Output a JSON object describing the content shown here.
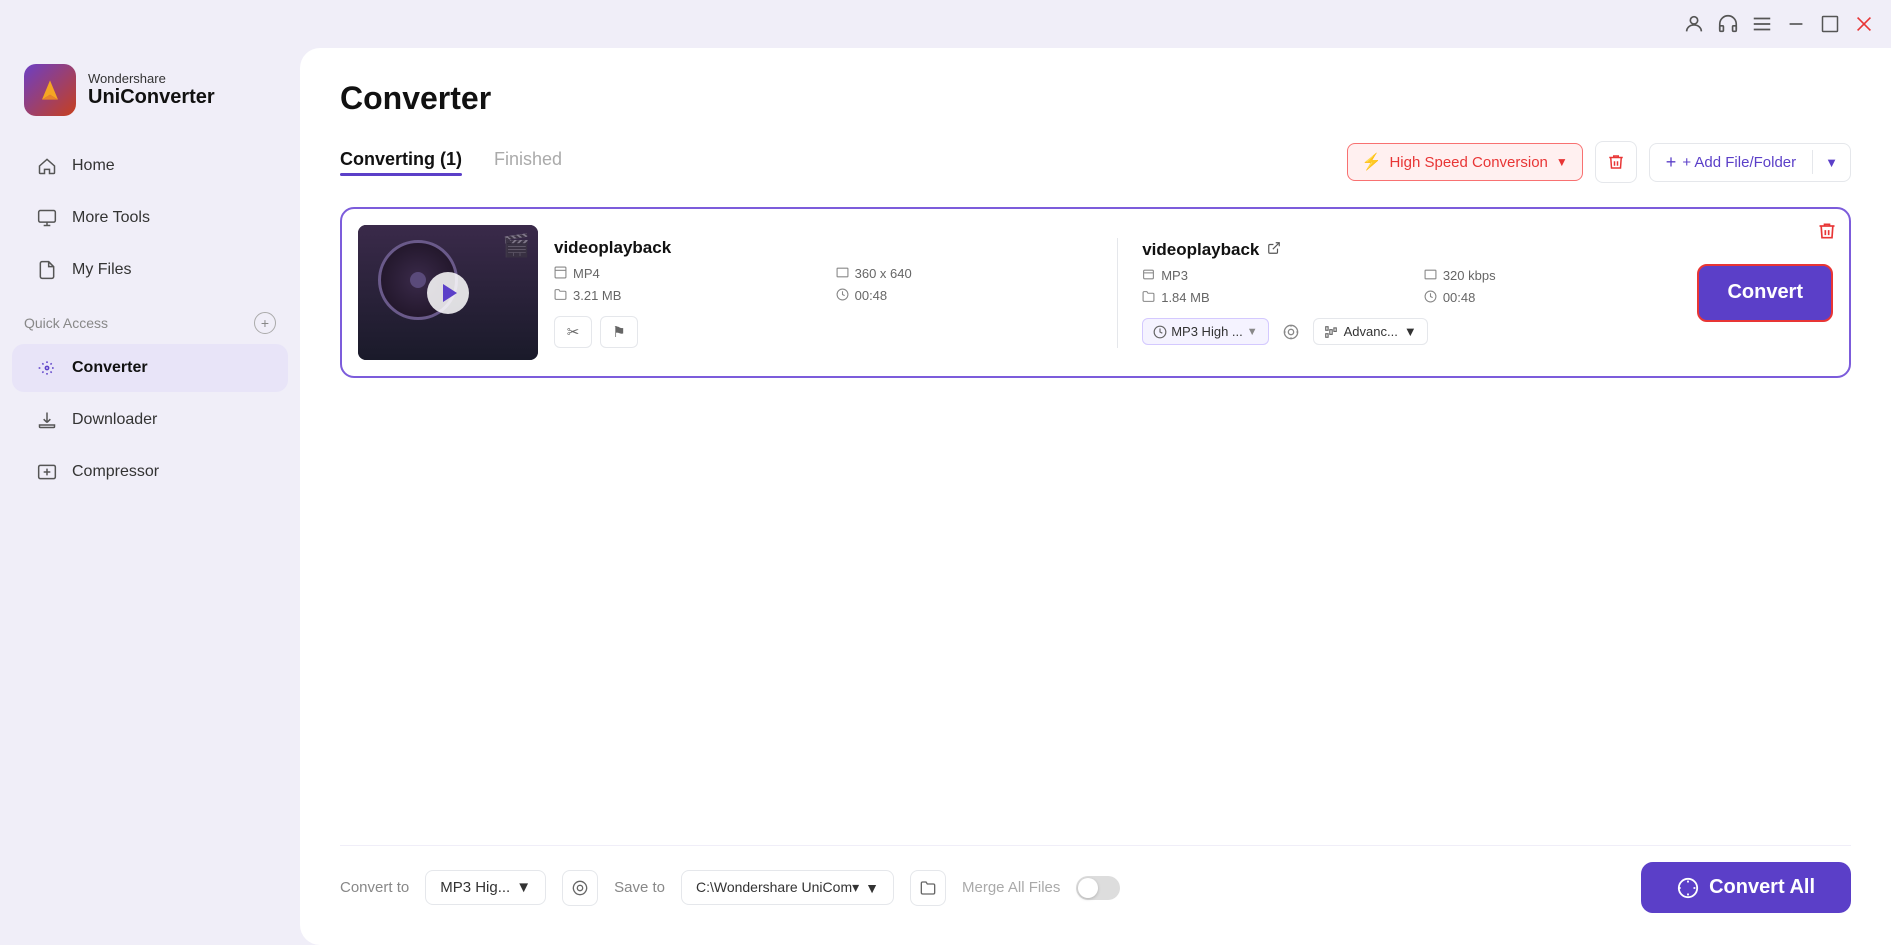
{
  "titlebar": {
    "icons": [
      "user-icon",
      "headset-icon",
      "menu-icon",
      "minimize-icon",
      "maximize-icon",
      "close-icon"
    ]
  },
  "logo": {
    "brand": "Wondershare",
    "product": "UniConverter"
  },
  "sidebar": {
    "nav_items": [
      {
        "id": "home",
        "label": "Home",
        "icon": "home-icon"
      },
      {
        "id": "more-tools",
        "label": "More Tools",
        "icon": "tools-icon"
      },
      {
        "id": "my-files",
        "label": "My Files",
        "icon": "files-icon"
      }
    ],
    "quick_access_label": "Quick Access",
    "quick_access_plus": "+",
    "active_items": [
      {
        "id": "converter",
        "label": "Converter",
        "icon": "converter-icon"
      },
      {
        "id": "downloader",
        "label": "Downloader",
        "icon": "downloader-icon"
      },
      {
        "id": "compressor",
        "label": "Compressor",
        "icon": "compressor-icon"
      }
    ]
  },
  "page": {
    "title": "Converter",
    "tabs": [
      {
        "id": "converting",
        "label": "Converting (1)",
        "active": true
      },
      {
        "id": "finished",
        "label": "Finished",
        "active": false
      }
    ]
  },
  "toolbar": {
    "high_speed_label": "High Speed Conversion",
    "add_file_label": "+ Add File/Folder"
  },
  "file_card": {
    "source_name": "videoplayback",
    "source_format": "MP4",
    "source_resolution": "360 x 640",
    "source_size": "3.21 MB",
    "source_duration": "00:48",
    "output_name": "videoplayback",
    "output_format": "MP3",
    "output_bitrate": "320 kbps",
    "output_size": "1.84 MB",
    "output_duration": "00:48",
    "quality_label": "MP3 High ...",
    "advanced_label": "Advanc...",
    "convert_label": "Convert"
  },
  "bottom_bar": {
    "convert_to_label": "Convert to",
    "format_label": "MP3 Hig...",
    "save_to_label": "Save to",
    "save_path": "C:\\Wondershare UniCom▾",
    "merge_label": "Merge All Files",
    "convert_all_label": "Convert All"
  }
}
